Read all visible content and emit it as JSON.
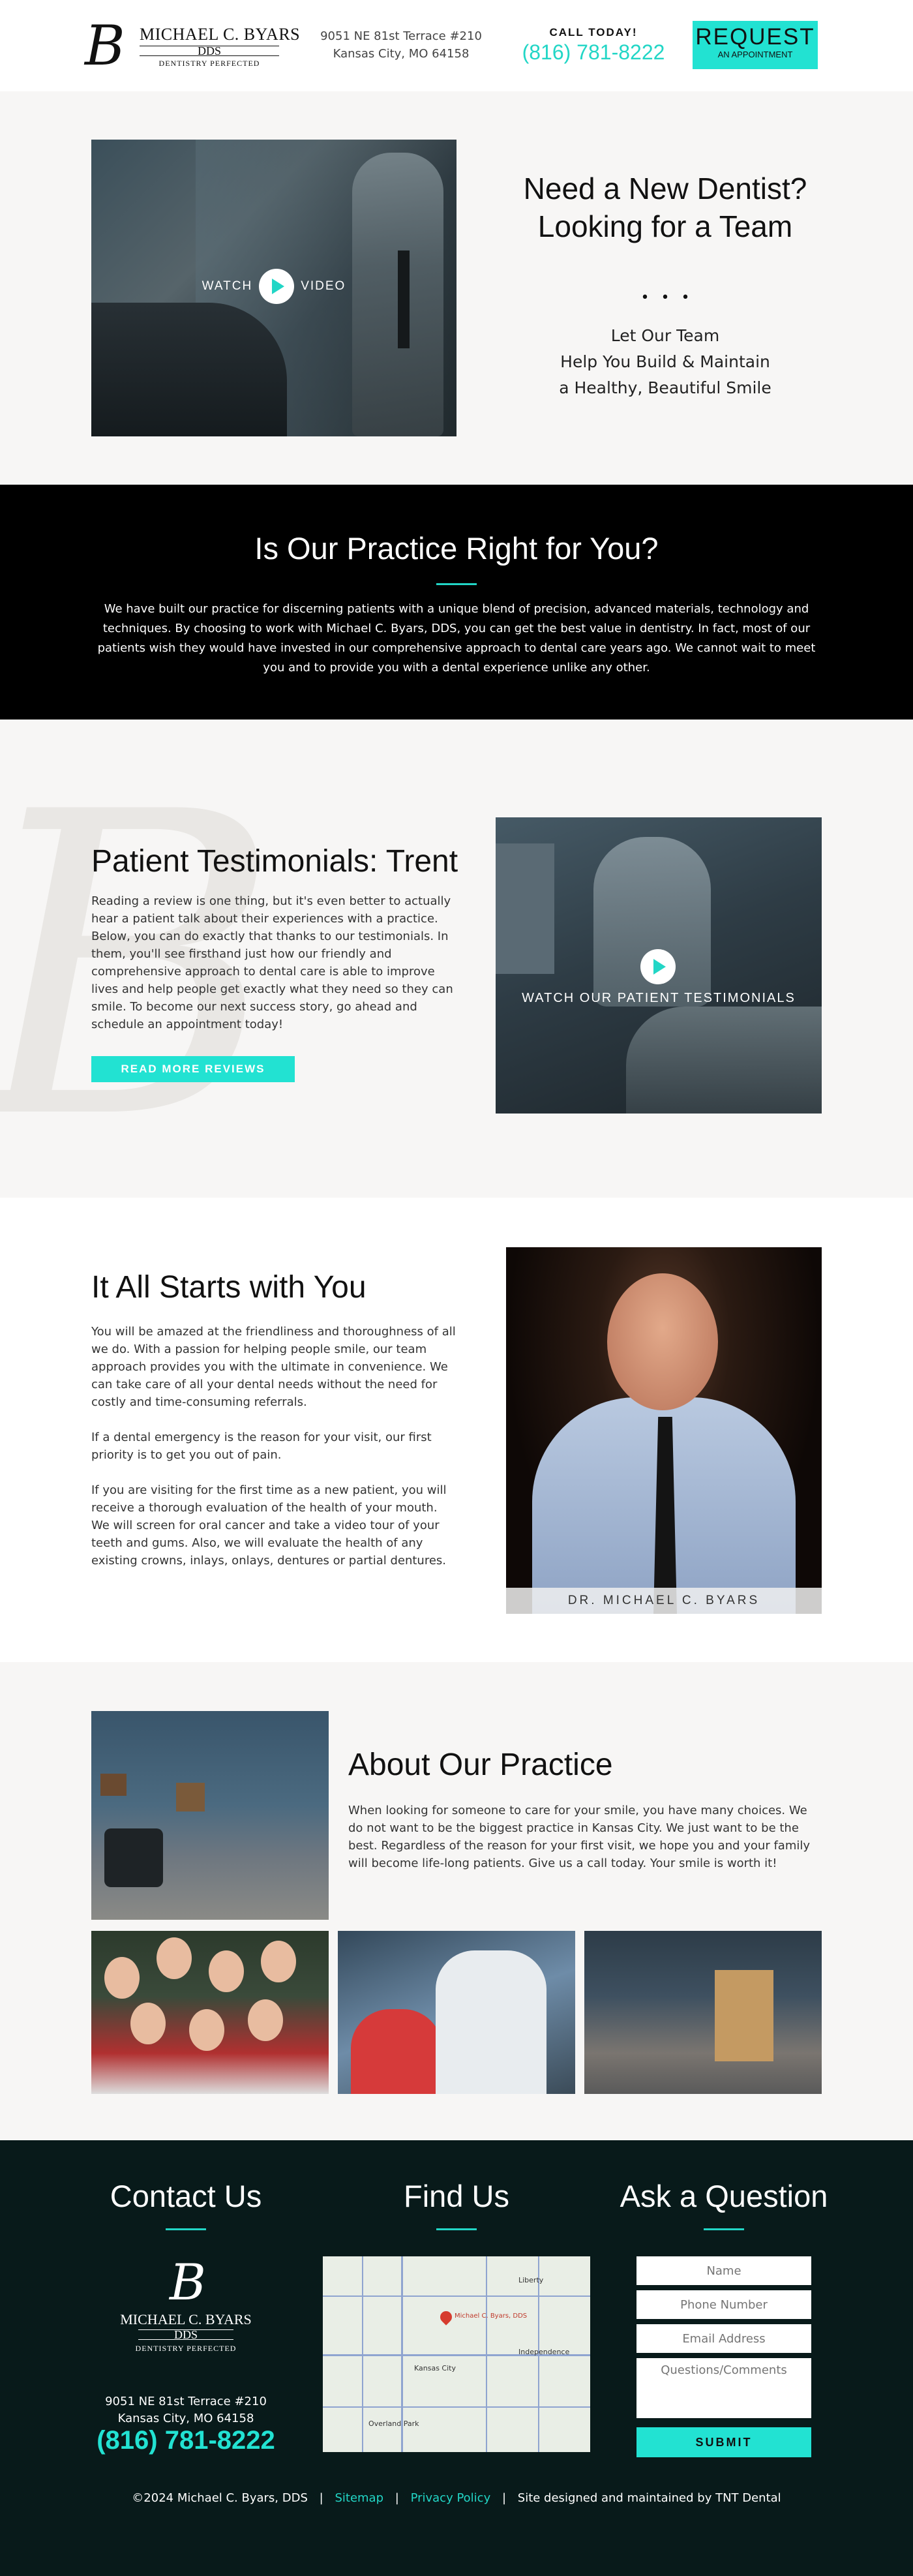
{
  "header": {
    "logo_letter": "B",
    "logo_name": "MICHAEL C. BYARS",
    "logo_dds": "DDS",
    "logo_tagline": "DENTISTRY PERFECTED",
    "address_line1": "9051 NE 81st Terrace #210",
    "address_line2": "Kansas City, MO 64158",
    "call_label": "CALL TODAY!",
    "phone": "(816) 781-8222",
    "request_big": "REQUEST",
    "request_small": "AN APPOINTMENT"
  },
  "hero": {
    "watch": "WATCH",
    "video": "VIDEO",
    "title_line1": "Need a New Dentist?",
    "title_line2": "Looking for a Team",
    "dots": "•••",
    "sub_line1": "Let Our Team",
    "sub_line2": "Help You Build & Maintain",
    "sub_line3": "a Healthy, Beautiful Smile"
  },
  "practice": {
    "title": "Is Our Practice Right for You?",
    "body": "We have built our practice for discerning patients with a unique blend of precision, advanced materials, technology and techniques. By choosing to work with Michael C. Byars, DDS, you can get the best value in dentistry. In fact, most of our patients wish they would have invested in our comprehensive approach to dental care years ago. We cannot wait to meet you and to provide you with a dental experience unlike any other."
  },
  "testimonials": {
    "title": "Patient Testimonials: Trent",
    "body": "Reading a review is one thing, but it's even better to actually hear a patient talk about their experiences with a practice. Below, you can do exactly that thanks to our testimonials. In them, you'll see firsthand just how our friendly and comprehensive approach to dental care is able to improve lives and help people get exactly what they need so they can smile. To become our next success story, go ahead and schedule an appointment today!",
    "button": "READ MORE REVIEWS",
    "video_caption": "WATCH OUR PATIENT TESTIMONIALS"
  },
  "starts": {
    "title": "It All Starts with You",
    "p1": "You will be amazed at the friendliness and thoroughness of all we do. With a passion for helping people smile, our team approach provides you with the ultimate in convenience. We can take care of all your dental needs without the need for costly and time-consuming referrals.",
    "p2": "If a dental emergency is the reason for your visit, our first priority is to get you out of pain.",
    "p3": "If you are visiting for the first time as a new patient, you will receive a thorough evaluation of the health of your mouth. We will screen for oral cancer and take a video tour of your teeth and gums. Also, we will evaluate the health of any existing crowns, inlays, onlays, dentures or partial dentures.",
    "photo_caption": "DR. MICHAEL C. BYARS"
  },
  "about": {
    "title": "About Our Practice",
    "body": "When looking for someone to care for your smile, you have many choices. We do not want to be the biggest practice in Kansas City. We just want to be the best. Regardless of the reason for your first visit, we hope you and your family will become life-long patients. Give us a call today. Your smile is worth it!"
  },
  "footer": {
    "contact_title": "Contact Us",
    "find_title": "Find Us",
    "ask_title": "Ask a Question",
    "logo_letter": "B",
    "logo_name": "MICHAEL C. BYARS",
    "logo_dds": "DDS",
    "logo_tagline": "DENTISTRY PERFECTED",
    "address_line1": "9051 NE 81st Terrace #210",
    "address_line2": "Kansas City, MO 64158",
    "phone": "(816) 781-8222",
    "map_pin_label": "Michael C. Byars, DDS",
    "map_labels": [
      "Kansas City",
      "Overland Park",
      "Independence",
      "Liberty"
    ],
    "form": {
      "name_placeholder": "Name",
      "phone_placeholder": "Phone Number",
      "email_placeholder": "Email Address",
      "comments_placeholder": "Questions/Comments",
      "submit": "SUBMIT"
    },
    "copyright": "©2024 Michael C. Byars, DDS",
    "sitemap": "Sitemap",
    "privacy": "Privacy Policy",
    "credit": "Site designed and maintained by TNT Dental",
    "separator": "|"
  },
  "colors": {
    "accent": "#22e2d2",
    "footer_bg": "#081a1a",
    "section_bg": "#f7f6f5"
  }
}
